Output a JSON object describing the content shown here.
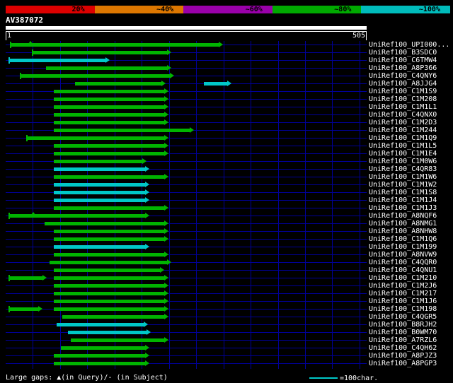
{
  "key": {
    "segments": [
      {
        "label": "20%",
        "color": "#dd0000"
      },
      {
        "label": "~40%",
        "color": "#dd7700"
      },
      {
        "label": "~60%",
        "color": "#9900aa"
      },
      {
        "label": "~80%",
        "color": "#00aa00"
      },
      {
        "label": "~100%",
        "color": "#00bbbb"
      }
    ]
  },
  "query": {
    "name": "AV387072",
    "start_label": "1",
    "end_label": "505"
  },
  "plot": {
    "x_min": 1,
    "x_max": 505,
    "gridlines": [
      39,
      77,
      115,
      153,
      191,
      229,
      267,
      305,
      343,
      381,
      419,
      457,
      495
    ],
    "grid_color": "#000099"
  },
  "colors": {
    "green": "#00b400",
    "cyan": "#00c8c8",
    "query": "#ffffff"
  },
  "chart_data": {
    "type": "bar",
    "orientation": "horizontal",
    "title": "AV387072",
    "x_range": [
      1,
      505
    ],
    "x_unit": "characters",
    "legend_note": "bar color = percent identity per key: red 20%, orange ~40%, purple ~60%, green ~80%, cyan ~100%",
    "rows": [
      {
        "label": "UniRef100_UPI000...",
        "segments": [
          {
            "start": 7,
            "end": 298,
            "color": "green",
            "tick": true
          }
        ],
        "marks": [
          36
        ]
      },
      {
        "label": "UniRef100_B3SDC0",
        "segments": [
          {
            "start": 38,
            "end": 226,
            "color": "green",
            "tick": true
          }
        ]
      },
      {
        "label": "UniRef100_C6TMW4",
        "segments": [
          {
            "start": 5,
            "end": 140,
            "color": "cyan",
            "tick": true
          }
        ]
      },
      {
        "label": "UniRef100_A8P366",
        "segments": [
          {
            "start": 57,
            "end": 226,
            "color": "green"
          }
        ]
      },
      {
        "label": "UniRef100_C4QNY6",
        "segments": [
          {
            "start": 21,
            "end": 230,
            "color": "green",
            "tick": true
          }
        ]
      },
      {
        "label": "UniRef100_A8JJG4",
        "segments": [
          {
            "start": 98,
            "end": 218,
            "color": "green"
          },
          {
            "start": 278,
            "end": 310,
            "color": "cyan"
          }
        ]
      },
      {
        "label": "UniRef100_C1M1S9",
        "segments": [
          {
            "start": 68,
            "end": 222,
            "color": "green"
          }
        ]
      },
      {
        "label": "UniRef100_C1M208",
        "segments": [
          {
            "start": 68,
            "end": 222,
            "color": "green"
          }
        ]
      },
      {
        "label": "UniRef100_C1M1L1",
        "segments": [
          {
            "start": 68,
            "end": 222,
            "color": "green"
          }
        ]
      },
      {
        "label": "UniRef100_C4QNX0",
        "segments": [
          {
            "start": 68,
            "end": 222,
            "color": "green"
          }
        ]
      },
      {
        "label": "UniRef100_C1M2D3",
        "segments": [
          {
            "start": 68,
            "end": 222,
            "color": "green"
          }
        ]
      },
      {
        "label": "UniRef100_C1M244",
        "segments": [
          {
            "start": 68,
            "end": 258,
            "color": "green"
          }
        ]
      },
      {
        "label": "UniRef100_C1M1Q9",
        "segments": [
          {
            "start": 30,
            "end": 222,
            "color": "green",
            "tick": true
          }
        ]
      },
      {
        "label": "UniRef100_C1M1L5",
        "segments": [
          {
            "start": 68,
            "end": 222,
            "color": "green"
          }
        ]
      },
      {
        "label": "UniRef100_C1M1E4",
        "segments": [
          {
            "start": 68,
            "end": 222,
            "color": "green"
          }
        ]
      },
      {
        "label": "UniRef100_C1M0W6",
        "segments": [
          {
            "start": 68,
            "end": 192,
            "color": "green"
          }
        ]
      },
      {
        "label": "UniRef100_C4QR83",
        "segments": [
          {
            "start": 68,
            "end": 196,
            "color": "cyan"
          }
        ]
      },
      {
        "label": "UniRef100_C1M1W6",
        "segments": [
          {
            "start": 68,
            "end": 222,
            "color": "green"
          }
        ]
      },
      {
        "label": "UniRef100_C1M1W2",
        "segments": [
          {
            "start": 68,
            "end": 196,
            "color": "cyan"
          }
        ]
      },
      {
        "label": "UniRef100_C1M1S8",
        "segments": [
          {
            "start": 68,
            "end": 196,
            "color": "cyan"
          }
        ]
      },
      {
        "label": "UniRef100_C1M1J4",
        "segments": [
          {
            "start": 68,
            "end": 196,
            "color": "cyan"
          }
        ]
      },
      {
        "label": "UniRef100_C1M1J3",
        "segments": [
          {
            "start": 68,
            "end": 222,
            "color": "green"
          }
        ]
      },
      {
        "label": "UniRef100_A8NQF6",
        "segments": [
          {
            "start": 5,
            "end": 196,
            "color": "green",
            "tick": true
          }
        ],
        "marks": [
          40
        ]
      },
      {
        "label": "UniRef100_A8NMG1",
        "segments": [
          {
            "start": 55,
            "end": 222,
            "color": "green"
          }
        ]
      },
      {
        "label": "UniRef100_A8NHW8",
        "segments": [
          {
            "start": 68,
            "end": 222,
            "color": "green"
          }
        ]
      },
      {
        "label": "UniRef100_C1M1Q6",
        "segments": [
          {
            "start": 68,
            "end": 222,
            "color": "green"
          }
        ]
      },
      {
        "label": "UniRef100_C1M199",
        "segments": [
          {
            "start": 68,
            "end": 196,
            "color": "cyan"
          }
        ]
      },
      {
        "label": "UniRef100_A8NVW9",
        "segments": [
          {
            "start": 68,
            "end": 222,
            "color": "green"
          }
        ]
      },
      {
        "label": "UniRef100_C4QQR0",
        "segments": [
          {
            "start": 62,
            "end": 226,
            "color": "green"
          }
        ]
      },
      {
        "label": "UniRef100_C4QNU1",
        "segments": [
          {
            "start": 68,
            "end": 216,
            "color": "green"
          }
        ]
      },
      {
        "label": "UniRef100_C1M210",
        "segments": [
          {
            "start": 5,
            "end": 52,
            "color": "green",
            "tick": true
          },
          {
            "start": 68,
            "end": 222,
            "color": "green"
          }
        ]
      },
      {
        "label": "UniRef100_C1M2J6",
        "segments": [
          {
            "start": 68,
            "end": 222,
            "color": "green"
          }
        ]
      },
      {
        "label": "UniRef100_C1M217",
        "segments": [
          {
            "start": 68,
            "end": 222,
            "color": "green"
          }
        ]
      },
      {
        "label": "UniRef100_C1M1J6",
        "segments": [
          {
            "start": 68,
            "end": 222,
            "color": "green"
          }
        ]
      },
      {
        "label": "UniRef100_C1M198",
        "segments": [
          {
            "start": 5,
            "end": 46,
            "color": "green",
            "tick": true
          },
          {
            "start": 68,
            "end": 222,
            "color": "green"
          }
        ]
      },
      {
        "label": "UniRef100_C4QGR5",
        "segments": [
          {
            "start": 80,
            "end": 222,
            "color": "green"
          }
        ]
      },
      {
        "label": "UniRef100_B8RJH2",
        "segments": [
          {
            "start": 72,
            "end": 194,
            "color": "cyan"
          }
        ]
      },
      {
        "label": "UniRef100_B0WM70",
        "segments": [
          {
            "start": 88,
            "end": 198,
            "color": "cyan"
          }
        ]
      },
      {
        "label": "UniRef100_A7RZL6",
        "segments": [
          {
            "start": 92,
            "end": 222,
            "color": "green"
          }
        ]
      },
      {
        "label": "UniRef100_C4QH62",
        "segments": [
          {
            "start": 78,
            "end": 196,
            "color": "green"
          }
        ]
      },
      {
        "label": "UniRef100_A8PJZ3",
        "segments": [
          {
            "start": 68,
            "end": 196,
            "color": "green"
          }
        ]
      },
      {
        "label": "UniRef100_A8PGP3",
        "segments": [
          {
            "start": 68,
            "end": 196,
            "color": "green"
          }
        ]
      }
    ]
  },
  "footer": {
    "gaps_note": "Large gaps: ▲(in Query)/- (in Subject)",
    "scale_label": "=100char.",
    "scale_color": "#00c8c8"
  }
}
